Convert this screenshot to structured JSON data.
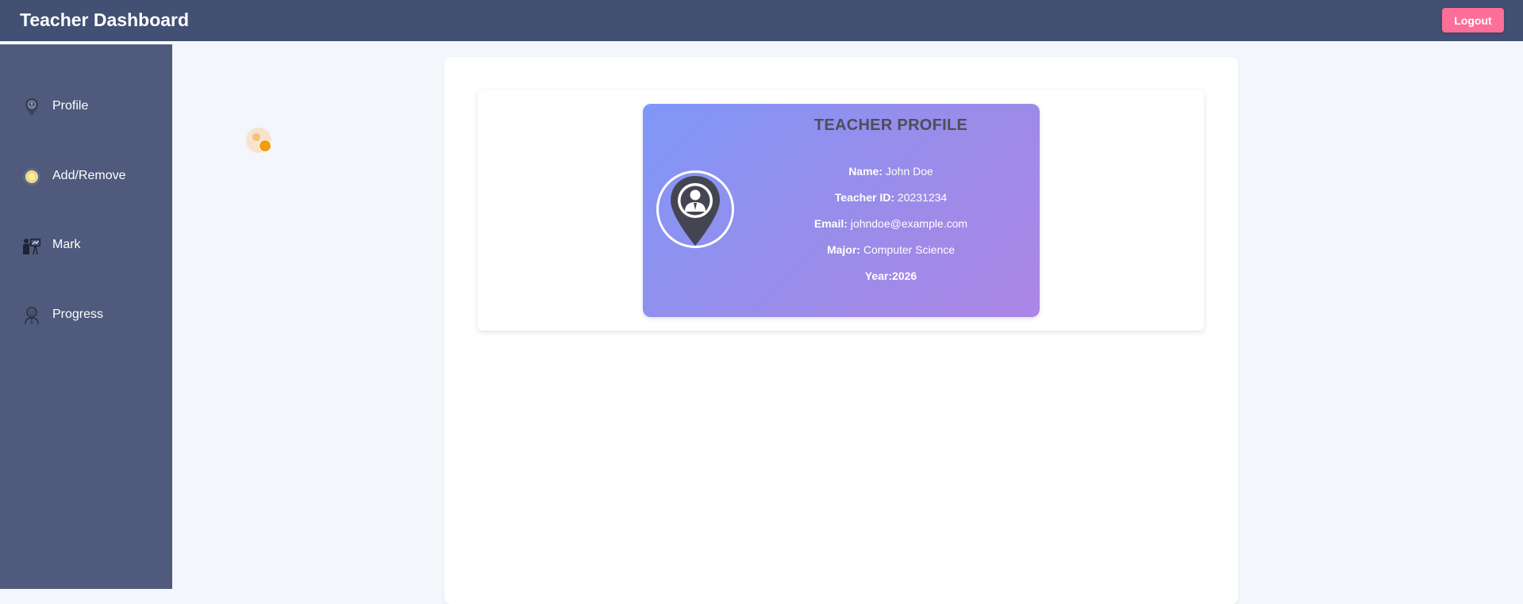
{
  "header": {
    "title": "Teacher Dashboard",
    "logout_label": "Logout"
  },
  "sidebar": {
    "items": [
      {
        "label": "Profile",
        "icon": "profile-pin-icon"
      },
      {
        "label": "Add/Remove",
        "icon": "add-remove-icon"
      },
      {
        "label": "Mark",
        "icon": "teacher-board-icon"
      },
      {
        "label": "Progress",
        "icon": "progress-person-icon"
      }
    ]
  },
  "profile": {
    "title": "TEACHER PROFILE",
    "fields": [
      {
        "label": "Name:",
        "value": "John Doe"
      },
      {
        "label": "Teacher ID:",
        "value": "20231234"
      },
      {
        "label": "Email:",
        "value": "johndoe@example.com"
      },
      {
        "label": "Major:",
        "value": "Computer Science"
      },
      {
        "label": "Year:",
        "value": "2026"
      }
    ]
  },
  "colors": {
    "header_bg": "#415073",
    "sidebar_bg": "#4f5a7c",
    "logout_bg": "#fd6e98",
    "card_gradient_start": "#7f97f8",
    "card_gradient_end": "#ac86e6",
    "loader_accent": "#f39c12"
  }
}
